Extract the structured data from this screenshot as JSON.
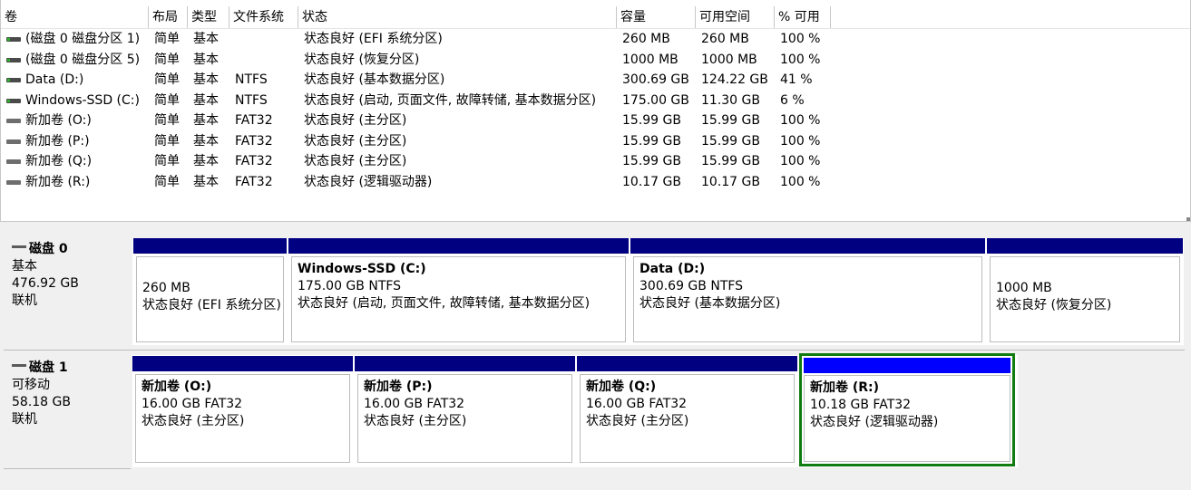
{
  "columns": [
    "卷",
    "布局",
    "类型",
    "文件系统",
    "状态",
    "容量",
    "可用空间",
    "% 可用"
  ],
  "volumes": [
    {
      "name": "(磁盘 0 磁盘分区 1)",
      "layout": "简单",
      "type": "基本",
      "fs": "",
      "status": "状态良好 (EFI 系统分区)",
      "capacity": "260 MB",
      "free": "260 MB",
      "pct": "100 %",
      "icon": "disk-green-icon"
    },
    {
      "name": "(磁盘 0 磁盘分区 5)",
      "layout": "简单",
      "type": "基本",
      "fs": "",
      "status": "状态良好 (恢复分区)",
      "capacity": "1000 MB",
      "free": "1000 MB",
      "pct": "100 %",
      "icon": "disk-green-icon"
    },
    {
      "name": "Data (D:)",
      "layout": "简单",
      "type": "基本",
      "fs": "NTFS",
      "status": "状态良好 (基本数据分区)",
      "capacity": "300.69 GB",
      "free": "124.22 GB",
      "pct": "41 %",
      "icon": "disk-green-icon"
    },
    {
      "name": "Windows-SSD (C:)",
      "layout": "简单",
      "type": "基本",
      "fs": "NTFS",
      "status": "状态良好 (启动, 页面文件, 故障转储, 基本数据分区)",
      "capacity": "175.00 GB",
      "free": "11.30 GB",
      "pct": "6 %",
      "icon": "disk-green-icon"
    },
    {
      "name": "新加卷 (O:)",
      "layout": "简单",
      "type": "基本",
      "fs": "FAT32",
      "status": "状态良好 (主分区)",
      "capacity": "15.99 GB",
      "free": "15.99 GB",
      "pct": "100 %",
      "icon": "disk-grey-icon"
    },
    {
      "name": "新加卷 (P:)",
      "layout": "简单",
      "type": "基本",
      "fs": "FAT32",
      "status": "状态良好 (主分区)",
      "capacity": "15.99 GB",
      "free": "15.99 GB",
      "pct": "100 %",
      "icon": "disk-grey-icon"
    },
    {
      "name": "新加卷 (Q:)",
      "layout": "简单",
      "type": "基本",
      "fs": "FAT32",
      "status": "状态良好 (主分区)",
      "capacity": "15.99 GB",
      "free": "15.99 GB",
      "pct": "100 %",
      "icon": "disk-grey-icon"
    },
    {
      "name": "新加卷 (R:)",
      "layout": "简单",
      "type": "基本",
      "fs": "FAT32",
      "status": "状态良好 (逻辑驱动器)",
      "capacity": "10.17 GB",
      "free": "10.17 GB",
      "pct": "100 %",
      "icon": "disk-grey-icon"
    }
  ],
  "disks": [
    {
      "name": "磁盘 0",
      "kind": "基本",
      "size": "476.92 GB",
      "state": "联机",
      "partitions": [
        {
          "title": "",
          "size": "260 MB",
          "status": "状态良好 (EFI 系统分区)"
        },
        {
          "title": "Windows-SSD  (C:)",
          "size": "175.00 GB NTFS",
          "status": "状态良好 (启动, 页面文件, 故障转储, 基本数据分区)"
        },
        {
          "title": "Data  (D:)",
          "size": "300.69 GB NTFS",
          "status": "状态良好 (基本数据分区)"
        },
        {
          "title": "",
          "size": "1000 MB",
          "status": "状态良好 (恢复分区)"
        }
      ]
    },
    {
      "name": "磁盘 1",
      "kind": "可移动",
      "size": "58.18 GB",
      "state": "联机",
      "partitions": [
        {
          "title": "新加卷  (O:)",
          "size": "16.00 GB FAT32",
          "status": "状态良好 (主分区)"
        },
        {
          "title": "新加卷  (P:)",
          "size": "16.00 GB FAT32",
          "status": "状态良好 (主分区)"
        },
        {
          "title": "新加卷  (Q:)",
          "size": "16.00 GB FAT32",
          "status": "状态良好 (主分区)"
        },
        {
          "title": "新加卷  (R:)",
          "size": "10.18 GB FAT32",
          "status": "状态良好 (逻辑驱动器)"
        }
      ]
    }
  ],
  "colors": {
    "primary_bar": "#000080",
    "logical_bar": "#0000ff",
    "selection": "#107c10"
  }
}
